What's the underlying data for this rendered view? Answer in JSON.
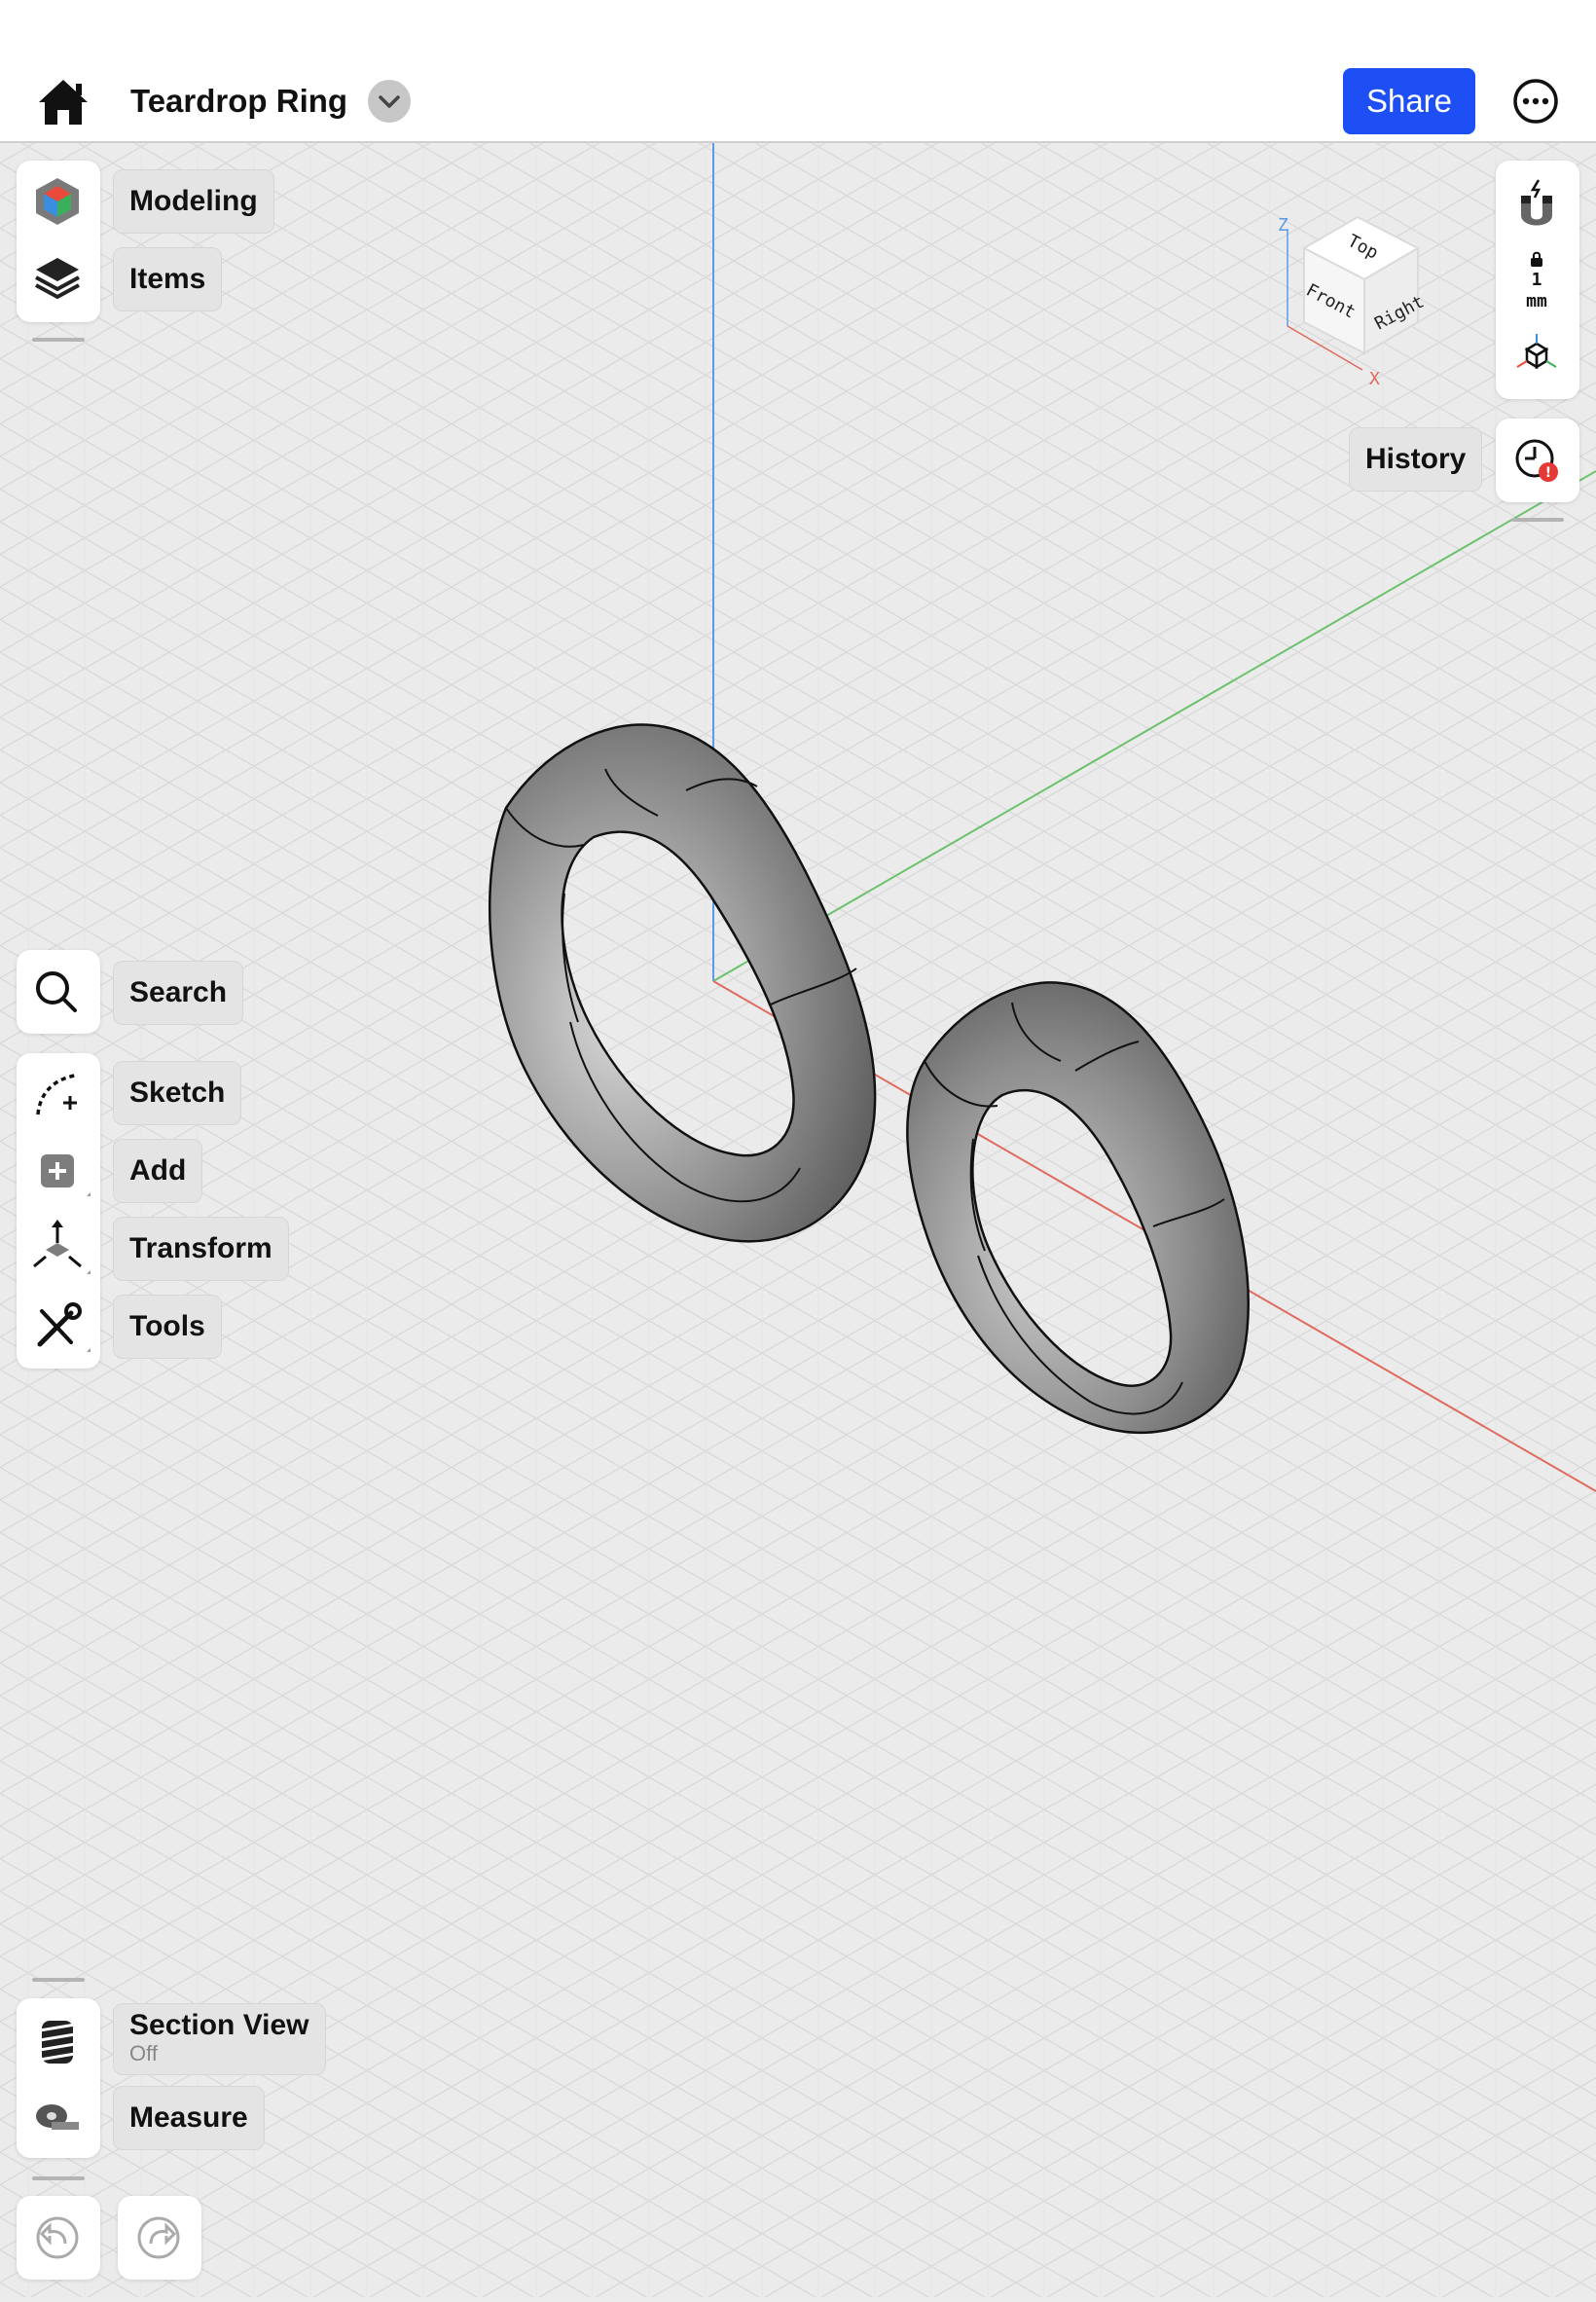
{
  "header": {
    "title": "Teardrop Ring",
    "share_label": "Share",
    "icons": [
      "home-icon",
      "chevron-down-icon",
      "more-icon"
    ]
  },
  "left_toolbar": {
    "top_group": [
      {
        "label": "Modeling",
        "icon": "modeling-cube-icon"
      },
      {
        "label": "Items",
        "icon": "layers-icon"
      }
    ],
    "search": {
      "label": "Search",
      "icon": "search-icon"
    },
    "tools_group": [
      {
        "label": "Sketch",
        "icon": "sketch-icon"
      },
      {
        "label": "Add",
        "icon": "add-icon"
      },
      {
        "label": "Transform",
        "icon": "transform-icon"
      },
      {
        "label": "Tools",
        "icon": "tools-icon"
      }
    ],
    "bottom_group": [
      {
        "label": "Section View",
        "sub": "Off",
        "icon": "section-view-icon"
      },
      {
        "label": "Measure",
        "icon": "tape-measure-icon"
      }
    ],
    "undo_redo": [
      "undo-icon",
      "redo-icon"
    ]
  },
  "right_toolbar": {
    "snap": {
      "icon": "magnet-icon",
      "value": "1",
      "unit": "mm"
    },
    "history_label": "History",
    "history_icon": "history-clock-icon"
  },
  "view_cube": {
    "faces": {
      "top": "Top",
      "front": "Front",
      "right": "Right"
    },
    "axes": {
      "z": "Z",
      "x": "X"
    }
  },
  "colors": {
    "accent": "#1d4ff5",
    "z_axis": "#5a9be8",
    "x_axis": "#e06a5e",
    "y_axis": "#6cc26c",
    "alert": "#e53935"
  }
}
